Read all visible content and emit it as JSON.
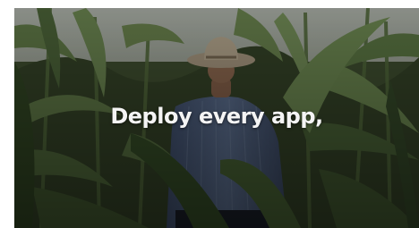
{
  "video": {
    "caption": "Deploy every app,",
    "scene_icon": "farmer-in-cornfield-image",
    "colors": {
      "sky": "#c9cfc5",
      "corn_dark": "#2c3a22",
      "corn_light": "#7d9a5c",
      "shirt": "#5a6f92",
      "hat": "#c9b79a",
      "caption": "#f4f4f4"
    }
  }
}
